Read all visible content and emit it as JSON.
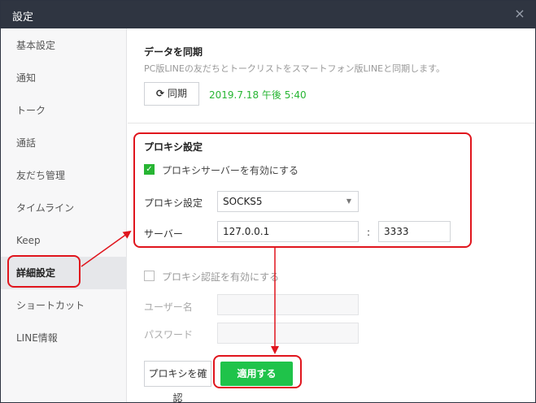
{
  "window": {
    "title": "設定",
    "close_glyph": "×"
  },
  "sidebar": {
    "items": [
      {
        "label": "基本設定"
      },
      {
        "label": "通知"
      },
      {
        "label": "トーク"
      },
      {
        "label": "通話"
      },
      {
        "label": "友だち管理"
      },
      {
        "label": "タイムライン"
      },
      {
        "label": "Keep"
      },
      {
        "label": "詳細設定",
        "active": true
      },
      {
        "label": "ショートカット"
      },
      {
        "label": "LINE情報"
      }
    ]
  },
  "sync": {
    "title": "データを同期",
    "description": "PC版LINEの友だちとトークリストをスマートフォン版LINEと同期します。",
    "button_label": "同期",
    "button_icon": "refresh-icon",
    "timestamp": "2019.7.18 午後 5:40"
  },
  "proxy": {
    "title": "プロキシ設定",
    "enable_server_label": "プロキシサーバーを有効にする",
    "enable_server_checked": true,
    "type_label": "プロキシ設定",
    "type_value": "SOCKS5",
    "server_label": "サーバー",
    "server_value": "127.0.0.1",
    "colon": ":",
    "port_value": "3333",
    "enable_auth_label": "プロキシ認証を有効にする",
    "enable_auth_checked": false,
    "username_label": "ユーザー名",
    "password_label": "パスワード",
    "check_button_label": "プロキシを確認",
    "apply_button_label": "適用する"
  },
  "colors": {
    "titlebar": "#2f3541",
    "accent_green": "#1fc34a",
    "annotation_red": "#e0151d"
  }
}
